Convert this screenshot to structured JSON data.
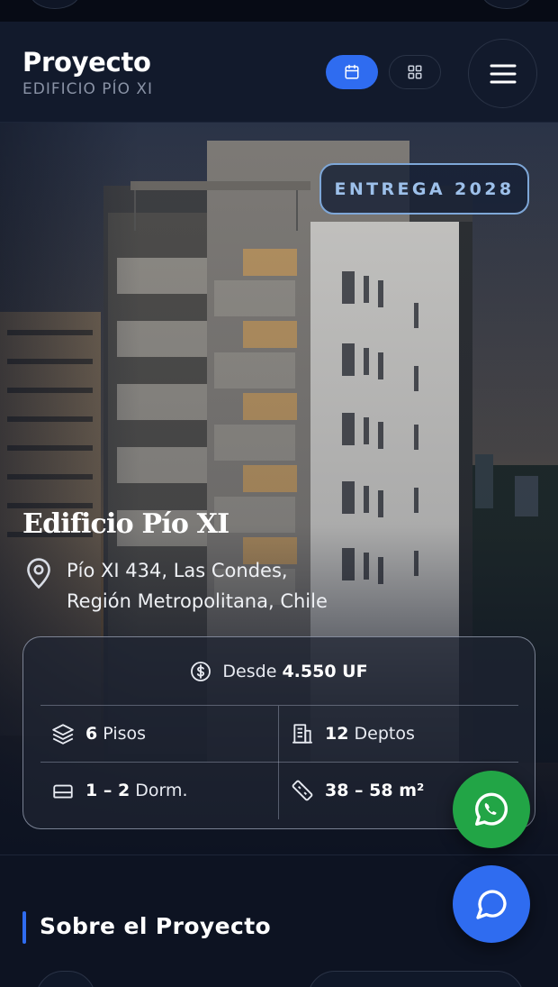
{
  "header": {
    "title": "Proyecto",
    "subtitle": "EDIFICIO PÍO XI",
    "icons": [
      "calendar-icon",
      "grid-icon",
      "menu-icon"
    ]
  },
  "hero": {
    "badge": "ENTREGA 2028",
    "title": "Edificio Pío XI",
    "address_line1": "Pío XI 434, Las Condes,",
    "address_line2": "Región Metropolitana, Chile"
  },
  "card": {
    "price_prefix": "Desde",
    "price_value": "4.550 UF",
    "floors_value": "6",
    "floors_label": "Pisos",
    "units_value": "12",
    "units_label": "Deptos",
    "bedrooms_value": "1 – 2",
    "bedrooms_label": "Dorm.",
    "area_value": "38 – 58 m²"
  },
  "section": {
    "title": "Sobre el Proyecto"
  },
  "colors": {
    "accent": "#2f6cf0",
    "whatsapp": "#22a546",
    "background": "#0d1322"
  }
}
